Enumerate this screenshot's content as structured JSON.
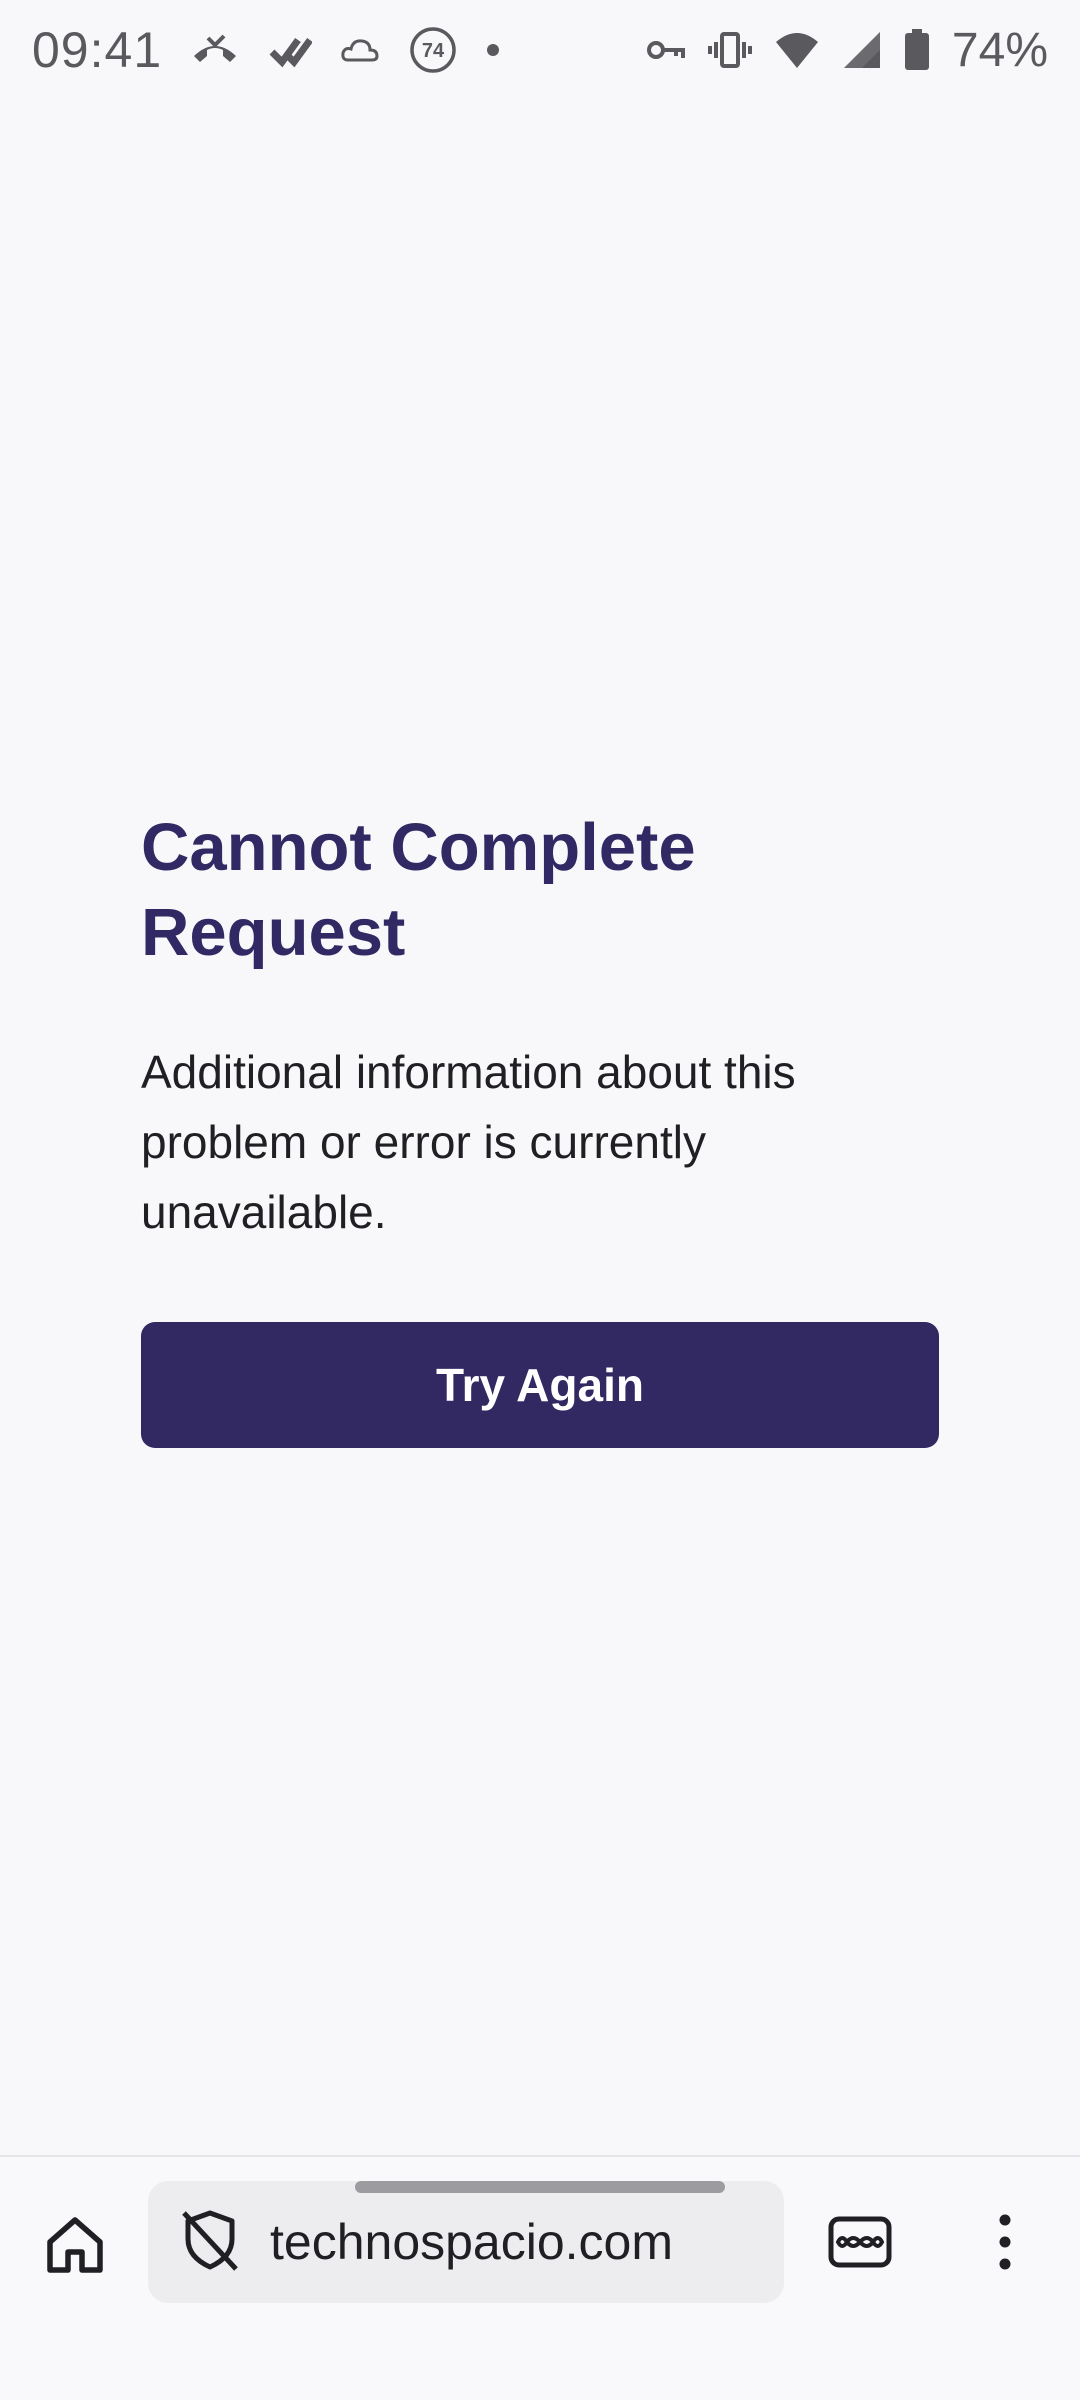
{
  "status_bar": {
    "time": "09:41",
    "notification_badge": "74",
    "battery_percent": "74%",
    "icons_left": [
      "missed-call-icon",
      "double-check-icon",
      "cloud-icon",
      "badge-74-icon",
      "dot-icon"
    ],
    "icons_right": [
      "vpn-key-icon",
      "vibrate-icon",
      "wifi-icon",
      "signal-icon",
      "battery-icon"
    ]
  },
  "error": {
    "title": "Cannot Complete Request",
    "message": "Additional information about this problem or error is currently unavailable.",
    "button_label": "Try Again"
  },
  "browser_bar": {
    "url": "technospacio.com",
    "icons": [
      "home-icon",
      "shield-off-icon",
      "tabs-icon",
      "more-vert-icon"
    ]
  },
  "colors": {
    "accent": "#322963",
    "title": "#312963",
    "background": "#f8f8fa",
    "url_bar": "#ededf0"
  }
}
